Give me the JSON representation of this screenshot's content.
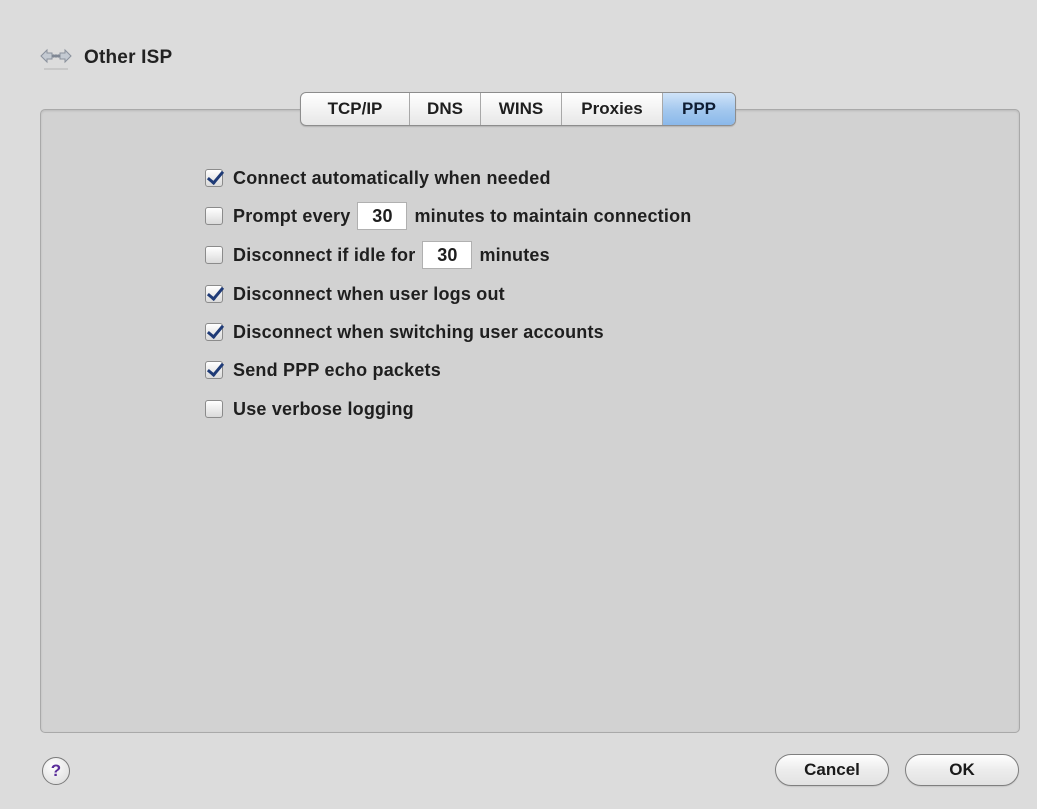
{
  "header": {
    "icon": "network-service-icon",
    "title": "Other ISP"
  },
  "tabs": [
    {
      "label": "TCP/IP",
      "active": false
    },
    {
      "label": "DNS",
      "active": false
    },
    {
      "label": "WINS",
      "active": false
    },
    {
      "label": "Proxies",
      "active": false
    },
    {
      "label": "PPP",
      "active": true
    }
  ],
  "options": {
    "connect_auto": {
      "checked": true,
      "label": "Connect automatically when needed"
    },
    "prompt": {
      "checked": false,
      "label_before": "Prompt every",
      "value": "30",
      "label_after": "minutes to maintain connection"
    },
    "idle": {
      "checked": false,
      "label_before": "Disconnect if idle for",
      "value": "30",
      "label_after": "minutes"
    },
    "logout": {
      "checked": true,
      "label": "Disconnect when user logs out"
    },
    "switching": {
      "checked": true,
      "label": "Disconnect when switching user accounts"
    },
    "echo": {
      "checked": true,
      "label": "Send PPP echo packets"
    },
    "verbose": {
      "checked": false,
      "label": "Use verbose logging"
    }
  },
  "footer": {
    "help_label": "?",
    "cancel_label": "Cancel",
    "ok_label": "OK"
  }
}
